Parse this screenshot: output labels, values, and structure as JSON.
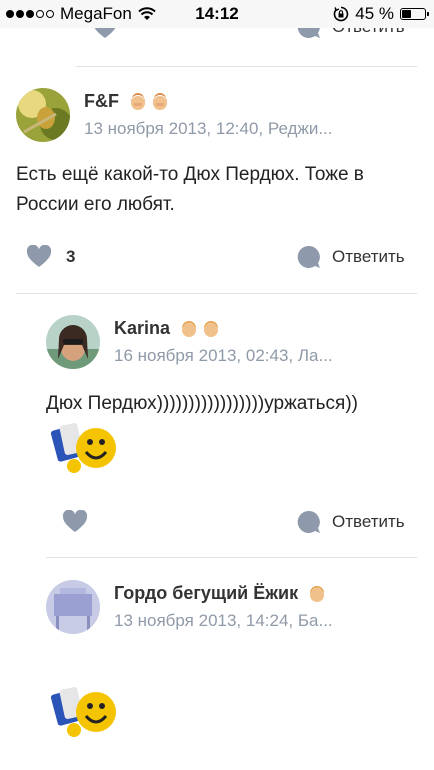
{
  "status_bar": {
    "carrier": "MegaFon",
    "time": "14:12",
    "battery": "45 %",
    "battery_level": 0.45
  },
  "reply_label": "Ответить",
  "comments": [
    {
      "author": "F&F",
      "meta": "13 ноября 2013, 12:40, Реджи...",
      "text": "Есть ещё какой-то Дюх Пердюх. Тоже в России его любят.",
      "likes": "3"
    },
    {
      "author": "Karina",
      "meta": "16 ноября 2013, 02:43, Ла...",
      "text": "Дюх Пердюх)))))))))))))))))уржаться))",
      "sticker": "smiley-sticker"
    },
    {
      "author": "Гордо бегущий Ёжик",
      "meta": "13 ноября 2013, 14:24, Ба...",
      "sticker": "smiley-sticker"
    }
  ],
  "colors": {
    "icon_gray": "#8e9aab",
    "meta_gray": "#8f9aa8",
    "divider": "#dfe3e8"
  }
}
